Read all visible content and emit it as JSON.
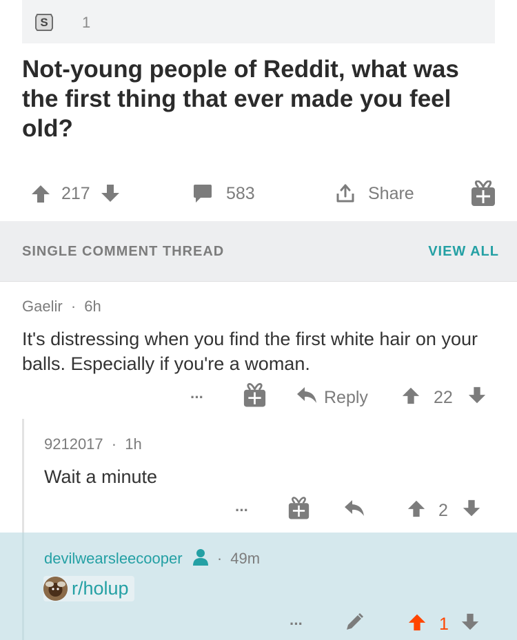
{
  "post": {
    "award_count": "1",
    "title": "Not-young people of Reddit, what was the first thing that ever made you feel old?",
    "upvotes": "217",
    "comments": "583",
    "share_label": "Share"
  },
  "thread": {
    "header_label": "SINGLE COMMENT THREAD",
    "view_all_label": "VIEW ALL"
  },
  "comments": [
    {
      "author": "Gaelir",
      "sep": "·",
      "age": "6h",
      "body": "It's distressing when you find the first white hair on your balls. Especially if you're a woman.",
      "more": "···",
      "reply_label": "Reply",
      "score": "22"
    },
    {
      "author": "9212017",
      "sep": "·",
      "age": "1h",
      "body": "Wait a minute",
      "more": "···",
      "score": "2"
    },
    {
      "author": "devilwearsleecooper",
      "sep": "·",
      "age": "49m",
      "flair": "r/holup",
      "more": "···",
      "score": "1"
    }
  ],
  "colors": {
    "accent_teal": "#24a0a4",
    "upvote_orange": "#ff4500",
    "highlight_bg": "#d5e8ed",
    "icon_gray": "#7c7c7c"
  },
  "icons": [
    "silver-award-icon",
    "upvote-icon",
    "downvote-icon",
    "comment-icon",
    "share-icon",
    "gift-icon",
    "more-icon",
    "reply-icon",
    "edit-icon",
    "user-icon"
  ]
}
